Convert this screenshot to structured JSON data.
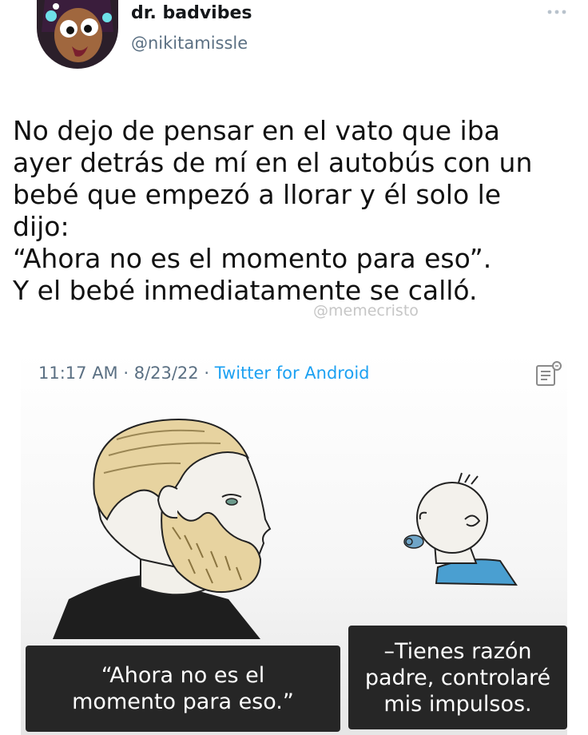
{
  "author": {
    "display_name": "dr. badvibes",
    "handle": "@nikitamissle",
    "avatar_icon": "cartoon-avatar-icon",
    "more_icon": "more-options-icon"
  },
  "tweet": {
    "lines": [
      "No dejo de pensar en el vato que iba",
      "ayer detrás de mí en el autobús con un",
      "bebé que empezó a llorar y él solo le",
      "dijo:",
      "“Ahora no es el momento para eso”.",
      "Y el bebé inmediatamente se calló."
    ],
    "watermark": "@memecristo"
  },
  "meme": {
    "timestamp": "11:17 AM · 8/23/22 · ",
    "source": "Twitter for Android",
    "notes_icon": "notes-icon",
    "caption_left": [
      "“Ahora no es el",
      "momento para eso.”"
    ],
    "caption_right": [
      "–Tienes razón",
      "padre, controlaré",
      "mis impulsos."
    ]
  },
  "colors": {
    "link_blue": "#1da1f2",
    "handle_gray": "#5b7083",
    "caption_bg": "#262626",
    "beard": "#e7d3a0",
    "shirt_blue": "#4a9fd1"
  }
}
